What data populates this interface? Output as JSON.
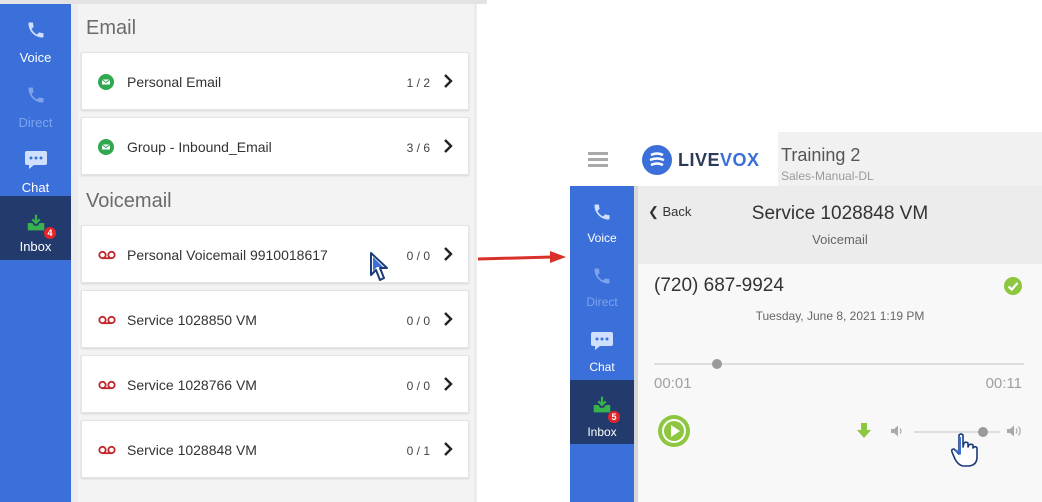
{
  "left_panel": {
    "nav": [
      {
        "label": "Voice",
        "icon": "phone-icon"
      },
      {
        "label": "Direct",
        "icon": "phone-icon"
      },
      {
        "label": "Chat",
        "icon": "chat-icon"
      },
      {
        "label": "Inbox",
        "icon": "inbox-icon",
        "badge": "4"
      }
    ],
    "email_title": "Email",
    "emails": [
      {
        "name": "Personal Email",
        "count": "1 / 2"
      },
      {
        "name": "Group - Inbound_Email",
        "count": "3 / 6"
      }
    ],
    "voicemail_title": "Voicemail",
    "voicemails": [
      {
        "name": "Personal Voicemail 9910018617",
        "count": "0 / 0"
      },
      {
        "name": "Service 1028850 VM",
        "count": "0 / 0"
      },
      {
        "name": "Service 1028766 VM",
        "count": "0 / 0"
      },
      {
        "name": "Service 1028848 VM",
        "count": "0 / 1"
      }
    ]
  },
  "right_panel": {
    "logo": {
      "live": "LIVE",
      "vox": "VOX"
    },
    "campaign": {
      "title": "Training 2",
      "subtitle": "Sales-Manual-DL"
    },
    "nav": [
      {
        "label": "Voice",
        "icon": "phone-icon"
      },
      {
        "label": "Direct",
        "icon": "phone-icon"
      },
      {
        "label": "Chat",
        "icon": "chat-icon"
      },
      {
        "label": "Inbox",
        "icon": "inbox-icon",
        "badge": "5"
      }
    ],
    "back_label": "Back",
    "title": "Service 1028848 VM",
    "subtitle": "Voicemail",
    "phone": "(720) 687-9924",
    "date": "Tuesday, June 8, 2021 1:19 PM",
    "time_current": "00:01",
    "time_total": "00:11",
    "playback_progress": 0.17,
    "volume_level": 0.8
  },
  "colors": {
    "sidebar": "#3b6fd9",
    "active_nav": "#233a6c",
    "email_icon": "#2fa84f",
    "voicemail_icon": "#c0282d",
    "accent_green": "#8dc63f",
    "arrow": "#d9302a"
  }
}
